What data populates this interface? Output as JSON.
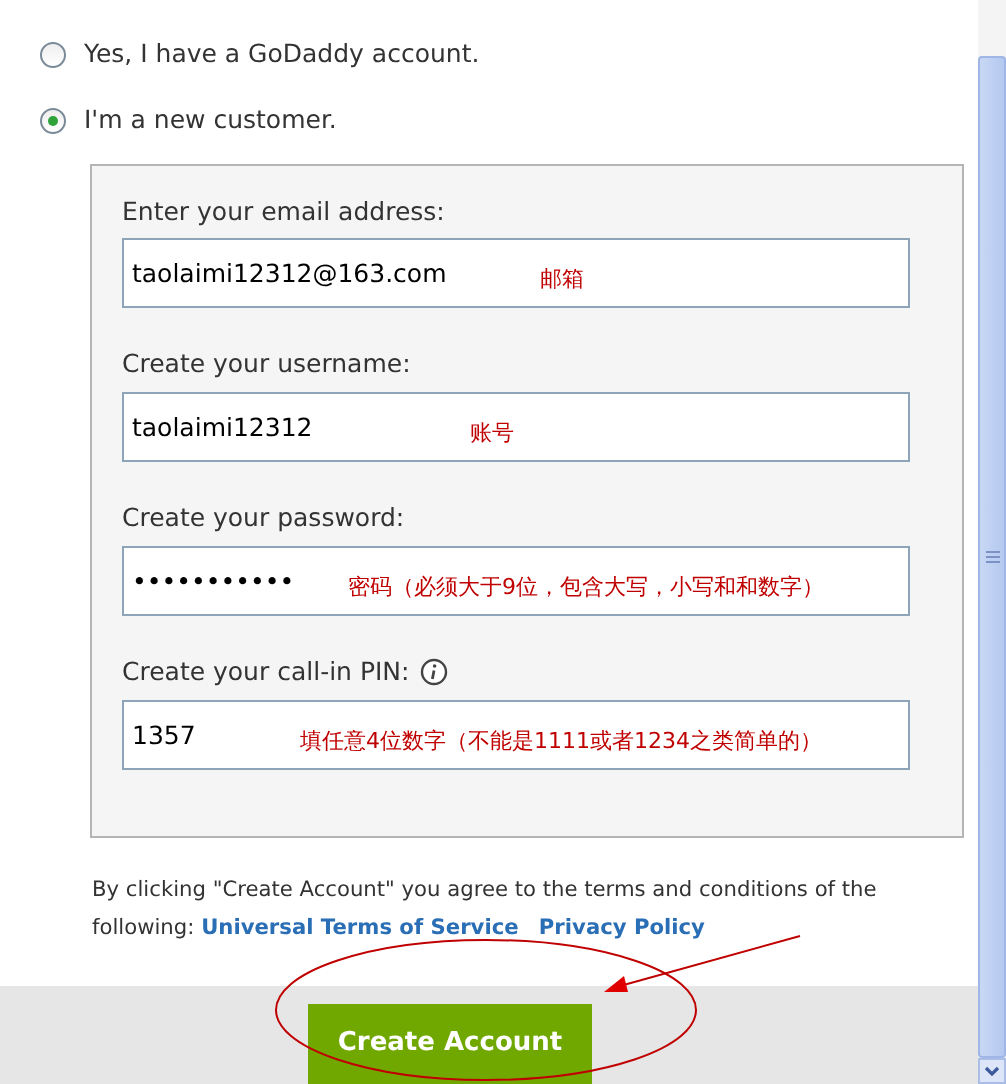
{
  "account_options": [
    {
      "label": "Yes, I have a GoDaddy account.",
      "selected": false
    },
    {
      "label": "I'm a new customer.",
      "selected": true
    }
  ],
  "fields": [
    {
      "label": "Enter your email address:",
      "value": "taolaimi12312@163.com",
      "annotation": "邮箱"
    },
    {
      "label": "Create your username:",
      "value": "taolaimi12312",
      "annotation": "账号"
    },
    {
      "label": "Create your password:",
      "value": "•••••••••••",
      "annotation": "密码（必须大于9位，包含大写，小写和和数字）"
    },
    {
      "label": "Create your call-in PIN:",
      "value": "1357",
      "annotation": "填任意4位数字（不能是1111或者1234之类简单的）",
      "info": true
    }
  ],
  "terms": {
    "text": "By clicking \"Create Account\" you agree to the terms and conditions of the following:",
    "links": [
      "Universal Terms of Service",
      "Privacy Policy"
    ]
  },
  "button": "Create Account"
}
